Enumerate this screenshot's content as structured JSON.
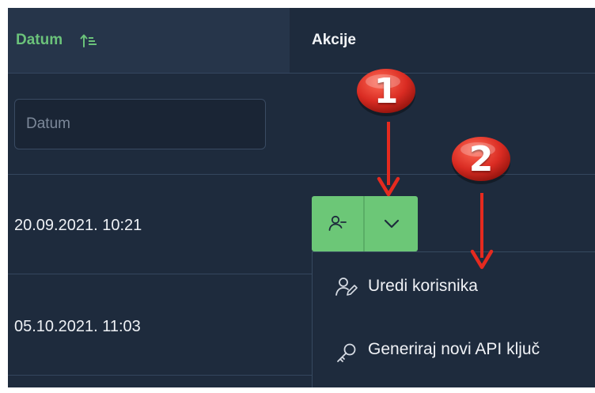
{
  "table": {
    "headers": {
      "date": "Datum",
      "actions": "Akcije"
    },
    "filter": {
      "date_placeholder": "Datum"
    },
    "rows": [
      {
        "date": "20.09.2021. 10:21"
      },
      {
        "date": "05.10.2021. 11:03"
      }
    ]
  },
  "dropdown": {
    "items": [
      {
        "label": "Uredi korisnika",
        "icon": "user-edit-icon"
      },
      {
        "label": "Generiraj novi API ključ",
        "icon": "key-icon"
      }
    ]
  },
  "annotations": {
    "marker_1": "1",
    "marker_2": "2"
  },
  "colors": {
    "accent_green": "#6cc777",
    "header_green_text": "#6bc27a",
    "background": "#1e2b3d",
    "marker_red": "#d92b22"
  }
}
